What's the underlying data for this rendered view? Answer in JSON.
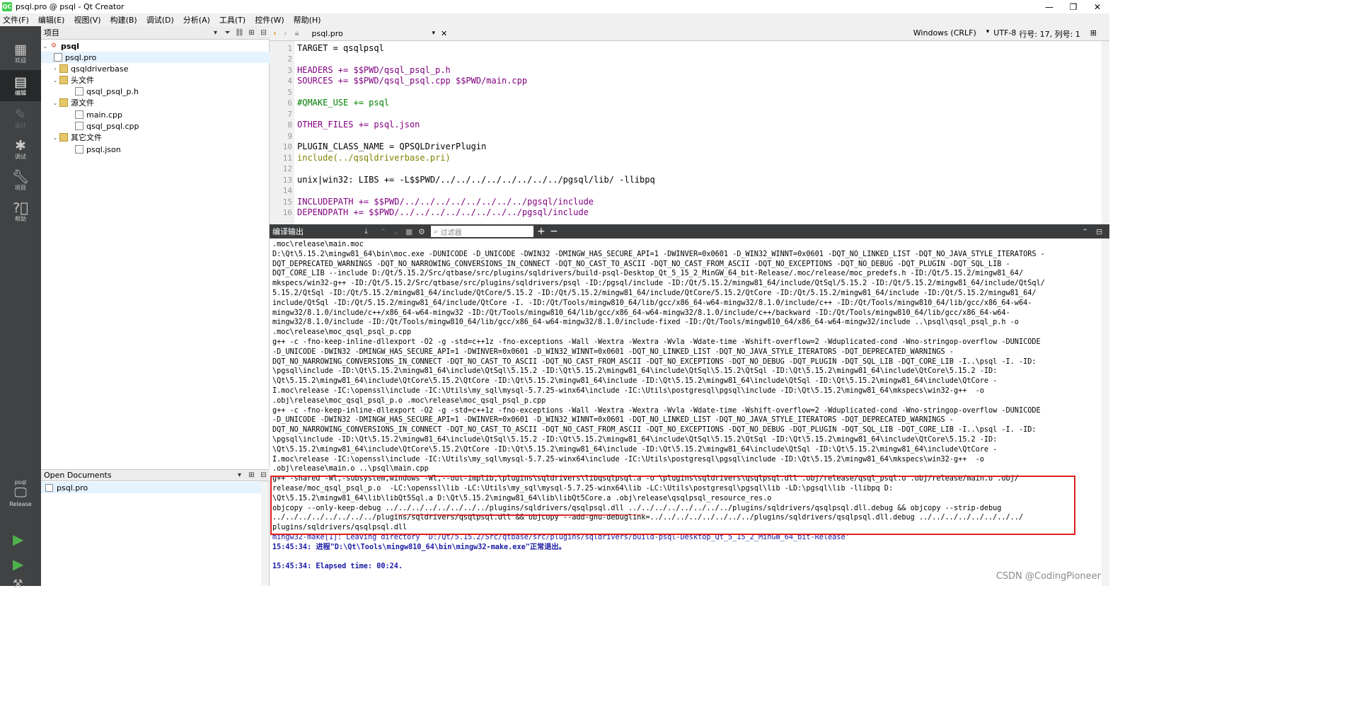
{
  "window": {
    "logo": "QC",
    "title": "psql.pro @ psql - Qt Creator",
    "controls": [
      "—",
      "❐",
      "✕"
    ]
  },
  "menu": [
    "文件(F)",
    "编辑(E)",
    "视图(V)",
    "构建(B)",
    "调试(D)",
    "分析(A)",
    "工具(T)",
    "控件(W)",
    "帮助(H)"
  ],
  "modes": [
    {
      "label": "欢迎",
      "icon": "grid-icon"
    },
    {
      "label": "编辑",
      "icon": "edit-icon"
    },
    {
      "label": "设计",
      "icon": "pencil-icon"
    },
    {
      "label": "调试",
      "icon": "bug-icon"
    },
    {
      "label": "项目",
      "icon": "wrench-icon"
    },
    {
      "label": "帮助",
      "icon": "help-icon"
    }
  ],
  "kit": {
    "project": "psql",
    "build": "Release"
  },
  "projects_panel": {
    "title": "项目"
  },
  "tree": [
    {
      "label": "psql",
      "level": 0,
      "type": "root",
      "expanded": true
    },
    {
      "label": "psql.pro",
      "level": 1,
      "type": "pro",
      "selected": true
    },
    {
      "label": "qsqldriverbase",
      "level": 1,
      "type": "folder",
      "expanded": false
    },
    {
      "label": "头文件",
      "level": 1,
      "type": "folder",
      "expanded": true
    },
    {
      "label": "qsql_psql_p.h",
      "level": 2,
      "type": "file"
    },
    {
      "label": "源文件",
      "level": 1,
      "type": "folder",
      "expanded": true
    },
    {
      "label": "main.cpp",
      "level": 2,
      "type": "file"
    },
    {
      "label": "qsql_psql.cpp",
      "level": 2,
      "type": "file"
    },
    {
      "label": "其它文件",
      "level": 1,
      "type": "folder",
      "expanded": true
    },
    {
      "label": "psql.json",
      "level": 2,
      "type": "file"
    }
  ],
  "open_documents": {
    "title": "Open Documents",
    "items": [
      "psql.pro"
    ]
  },
  "editor": {
    "file": "psql.pro",
    "line_ending": "Windows (CRLF)",
    "encoding": "UTF-8",
    "position": "行号: 17, 列号: 1",
    "lines": [
      "TARGET = qsqlpsql",
      "",
      "HEADERS += $$PWD/qsql_psql_p.h",
      "SOURCES += $$PWD/qsql_psql.cpp $$PWD/main.cpp",
      "",
      "#QMAKE_USE += psql",
      "",
      "OTHER_FILES += psql.json",
      "",
      "PLUGIN_CLASS_NAME = QPSQLDriverPlugin",
      "include(../qsqldriverbase.pri)",
      "",
      "unix|win32: LIBS += -L$$PWD/../../../../../../../../pgsql/lib/ -llibpq",
      "",
      "INCLUDEPATH += $$PWD/../../../../../../../../pgsql/include",
      "DEPENDPATH += $$PWD/../../../../../../../../pgsql/include"
    ]
  },
  "output_panel": {
    "title": "编译输出",
    "filter_placeholder": "过滤器",
    "lines": [
      ".moc\\release\\main.moc",
      "D:\\Qt\\5.15.2\\mingw81_64\\bin\\moc.exe -DUNICODE -D_UNICODE -DWIN32 -DMINGW_HAS_SECURE_API=1 -DWINVER=0x0601 -D_WIN32_WINNT=0x0601 -DQT_NO_LINKED_LIST -DQT_NO_JAVA_STYLE_ITERATORS -",
      "DQT_DEPRECATED_WARNINGS -DQT_NO_NARROWING_CONVERSIONS_IN_CONNECT -DQT_NO_CAST_TO_ASCII -DQT_NO_CAST_FROM_ASCII -DQT_NO_EXCEPTIONS -DQT_NO_DEBUG -DQT_PLUGIN -DQT_SQL_LIB -",
      "DQT_CORE_LIB --include D:/Qt/5.15.2/Src/qtbase/src/plugins/sqldrivers/build-psql-Desktop_Qt_5_15_2_MinGW_64_bit-Release/.moc/release/moc_predefs.h -ID:/Qt/5.15.2/mingw81_64/",
      "mkspecs/win32-g++ -ID:/Qt/5.15.2/Src/qtbase/src/plugins/sqldrivers/psql -ID:/pgsql/include -ID:/Qt/5.15.2/mingw81_64/include/QtSql/5.15.2 -ID:/Qt/5.15.2/mingw81_64/include/QtSql/",
      "5.15.2/QtSql -ID:/Qt/5.15.2/mingw81_64/include/QtCore/5.15.2 -ID:/Qt/5.15.2/mingw81_64/include/QtCore/5.15.2/QtCore -ID:/Qt/5.15.2/mingw81_64/include -ID:/Qt/5.15.2/mingw81_64/",
      "include/QtSql -ID:/Qt/5.15.2/mingw81_64/include/QtCore -I. -ID:/Qt/Tools/mingw810_64/lib/gcc/x86_64-w64-mingw32/8.1.0/include/c++ -ID:/Qt/Tools/mingw810_64/lib/gcc/x86_64-w64-",
      "mingw32/8.1.0/include/c++/x86_64-w64-mingw32 -ID:/Qt/Tools/mingw810_64/lib/gcc/x86_64-w64-mingw32/8.1.0/include/c++/backward -ID:/Qt/Tools/mingw810_64/lib/gcc/x86_64-w64-",
      "mingw32/8.1.0/include -ID:/Qt/Tools/mingw810_64/lib/gcc/x86_64-w64-mingw32/8.1.0/include-fixed -ID:/Qt/Tools/mingw810_64/x86_64-w64-mingw32/include ..\\psql\\qsql_psql_p.h -o",
      ".moc\\release\\moc_qsql_psql_p.cpp",
      "g++ -c -fno-keep-inline-dllexport -O2 -g -std=c++1z -fno-exceptions -Wall -Wextra -Wextra -Wvla -Wdate-time -Wshift-overflow=2 -Wduplicated-cond -Wno-stringop-overflow -DUNICODE",
      "-D_UNICODE -DWIN32 -DMINGW_HAS_SECURE_API=1 -DWINVER=0x0601 -D_WIN32_WINNT=0x0601 -DQT_NO_LINKED_LIST -DQT_NO_JAVA_STYLE_ITERATORS -DQT_DEPRECATED_WARNINGS -",
      "DQT_NO_NARROWING_CONVERSIONS_IN_CONNECT -DQT_NO_CAST_TO_ASCII -DQT_NO_CAST_FROM_ASCII -DQT_NO_EXCEPTIONS -DQT_NO_DEBUG -DQT_PLUGIN -DQT_SQL_LIB -DQT_CORE_LIB -I..\\psql -I. -ID:",
      "\\pgsql\\include -ID:\\Qt\\5.15.2\\mingw81_64\\include\\QtSql\\5.15.2 -ID:\\Qt\\5.15.2\\mingw81_64\\include\\QtSql\\5.15.2\\QtSql -ID:\\Qt\\5.15.2\\mingw81_64\\include\\QtCore\\5.15.2 -ID:",
      "\\Qt\\5.15.2\\mingw81_64\\include\\QtCore\\5.15.2\\QtCore -ID:\\Qt\\5.15.2\\mingw81_64\\include -ID:\\Qt\\5.15.2\\mingw81_64\\include\\QtSql -ID:\\Qt\\5.15.2\\mingw81_64\\include\\QtCore -",
      "I.moc\\release -IC:\\openssl\\include -IC:\\Utils\\my_sql\\mysql-5.7.25-winx64\\include -IC:\\Utils\\postgresql\\pgsql\\include -ID:\\Qt\\5.15.2\\mingw81_64\\mkspecs\\win32-g++  -o",
      ".obj\\release\\moc_qsql_psql_p.o .moc\\release\\moc_qsql_psql_p.cpp",
      "g++ -c -fno-keep-inline-dllexport -O2 -g -std=c++1z -fno-exceptions -Wall -Wextra -Wextra -Wvla -Wdate-time -Wshift-overflow=2 -Wduplicated-cond -Wno-stringop-overflow -DUNICODE",
      "-D_UNICODE -DWIN32 -DMINGW_HAS_SECURE_API=1 -DWINVER=0x0601 -D_WIN32_WINNT=0x0601 -DQT_NO_LINKED_LIST -DQT_NO_JAVA_STYLE_ITERATORS -DQT_DEPRECATED_WARNINGS -",
      "DQT_NO_NARROWING_CONVERSIONS_IN_CONNECT -DQT_NO_CAST_TO_ASCII -DQT_NO_CAST_FROM_ASCII -DQT_NO_EXCEPTIONS -DQT_NO_DEBUG -DQT_PLUGIN -DQT_SQL_LIB -DQT_CORE_LIB -I..\\psql -I. -ID:",
      "\\pgsql\\include -ID:\\Qt\\5.15.2\\mingw81_64\\include\\QtSql\\5.15.2 -ID:\\Qt\\5.15.2\\mingw81_64\\include\\QtSql\\5.15.2\\QtSql -ID:\\Qt\\5.15.2\\mingw81_64\\include\\QtCore\\5.15.2 -ID:",
      "\\Qt\\5.15.2\\mingw81_64\\include\\QtCore\\5.15.2\\QtCore -ID:\\Qt\\5.15.2\\mingw81_64\\include -ID:\\Qt\\5.15.2\\mingw81_64\\include\\QtSql -ID:\\Qt\\5.15.2\\mingw81_64\\include\\QtCore -",
      "I.moc\\release -IC:\\openssl\\include -IC:\\Utils\\my_sql\\mysql-5.7.25-winx64\\include -IC:\\Utils\\postgresql\\pgsql\\include -ID:\\Qt\\5.15.2\\mingw81_64\\mkspecs\\win32-g++  -o",
      ".obj\\release\\main.o ..\\psql\\main.cpp",
      "g++ -shared -Wl,-subsystem,windows -Wl,--out-implib,\\plugins\\sqldrivers\\libqsqlpsql.a -o \\plugins\\sqldrivers\\qsqlpsql.dll .obj/release/qsql_psql.o .obj/release/main.o .obj/",
      "release/moc_qsql_psql_p.o  -LC:\\openssl\\lib -LC:\\Utils\\my_sql\\mysql-5.7.25-winx64\\lib -LC:\\Utils\\postgresql\\pgsql\\lib -LD:\\pgsql\\lib -llibpq D:",
      "\\Qt\\5.15.2\\mingw81_64\\lib\\libQt5Sql.a D:\\Qt\\5.15.2\\mingw81_64\\lib\\libQt5Core.a .obj\\release\\qsqlpsql_resource_res.o",
      "objcopy --only-keep-debug ../../../../../../../../plugins/sqldrivers/qsqlpsql.dll ../../../../../../../../plugins/sqldrivers/qsqlpsql.dll.debug && objcopy --strip-debug",
      "../../../../../../../../plugins/sqldrivers/qsqlpsql.dll && objcopy --add-gnu-debuglink=../../../../../../../../plugins/sqldrivers/qsqlpsql.dll.debug ../../../../../../../../",
      "plugins/sqldrivers/qsqlpsql.dll",
      "mingw32-make[1]: Leaving directory 'D:/Qt/5.15.2/Src/qtbase/src/plugins/sqldrivers/build-psql-Desktop_Qt_5_15_2_MinGW_64_bit-Release'",
      "15:45:34: 进程\"D:\\Qt\\Tools\\mingw810_64\\bin\\mingw32-make.exe\"正常退出。",
      "",
      "15:45:34: Elapsed time: 00:24."
    ]
  },
  "watermark": "CSDN @CodingPioneer"
}
